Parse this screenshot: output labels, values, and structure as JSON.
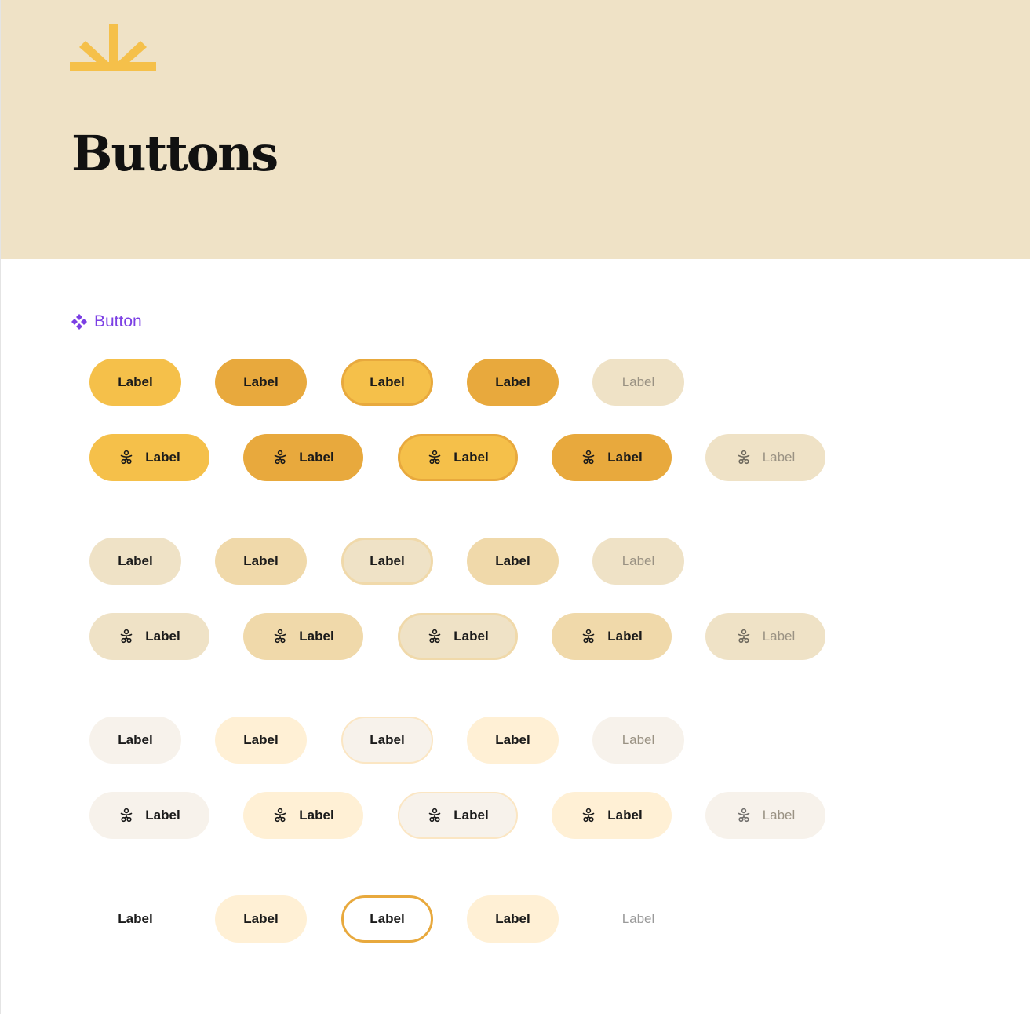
{
  "page": {
    "title": "Buttons",
    "component_name": "Button",
    "logo_icon": "sun-rays-logo",
    "colors": {
      "header_bg": "#efe2c6",
      "primary": "#f5c04a",
      "primary_dark": "#e8a93d",
      "component_label": "#7b3fe4"
    }
  },
  "groups": [
    {
      "variant": "primary",
      "rows": [
        {
          "icon": false,
          "buttons": [
            {
              "state": "default",
              "label": "Label"
            },
            {
              "state": "hover",
              "label": "Label"
            },
            {
              "state": "focus",
              "label": "Label"
            },
            {
              "state": "active",
              "label": "Label"
            },
            {
              "state": "disabled",
              "label": "Label"
            }
          ]
        },
        {
          "icon": true,
          "icon_name": "person-icon",
          "buttons": [
            {
              "state": "default",
              "label": "Label"
            },
            {
              "state": "hover",
              "label": "Label"
            },
            {
              "state": "focus",
              "label": "Label"
            },
            {
              "state": "active",
              "label": "Label"
            },
            {
              "state": "disabled",
              "label": "Label"
            }
          ]
        }
      ]
    },
    {
      "variant": "secondary",
      "rows": [
        {
          "icon": false,
          "buttons": [
            {
              "state": "default",
              "label": "Label"
            },
            {
              "state": "hover",
              "label": "Label"
            },
            {
              "state": "focus",
              "label": "Label"
            },
            {
              "state": "active",
              "label": "Label"
            },
            {
              "state": "disabled",
              "label": "Label"
            }
          ]
        },
        {
          "icon": true,
          "icon_name": "person-icon",
          "buttons": [
            {
              "state": "default",
              "label": "Label"
            },
            {
              "state": "hover",
              "label": "Label"
            },
            {
              "state": "focus",
              "label": "Label"
            },
            {
              "state": "active",
              "label": "Label"
            },
            {
              "state": "disabled",
              "label": "Label"
            }
          ]
        }
      ]
    },
    {
      "variant": "tertiary",
      "rows": [
        {
          "icon": false,
          "buttons": [
            {
              "state": "default",
              "label": "Label"
            },
            {
              "state": "hover",
              "label": "Label"
            },
            {
              "state": "focus",
              "label": "Label"
            },
            {
              "state": "active",
              "label": "Label"
            },
            {
              "state": "disabled",
              "label": "Label"
            }
          ]
        },
        {
          "icon": true,
          "icon_name": "person-icon",
          "buttons": [
            {
              "state": "default",
              "label": "Label"
            },
            {
              "state": "hover",
              "label": "Label"
            },
            {
              "state": "focus",
              "label": "Label"
            },
            {
              "state": "active",
              "label": "Label"
            },
            {
              "state": "disabled",
              "label": "Label"
            }
          ]
        }
      ]
    },
    {
      "variant": "ghost",
      "rows": [
        {
          "icon": false,
          "buttons": [
            {
              "state": "default",
              "label": "Label"
            },
            {
              "state": "hover",
              "label": "Label"
            },
            {
              "state": "focus",
              "label": "Label"
            },
            {
              "state": "active",
              "label": "Label"
            },
            {
              "state": "disabled",
              "label": "Label"
            }
          ]
        }
      ]
    }
  ]
}
